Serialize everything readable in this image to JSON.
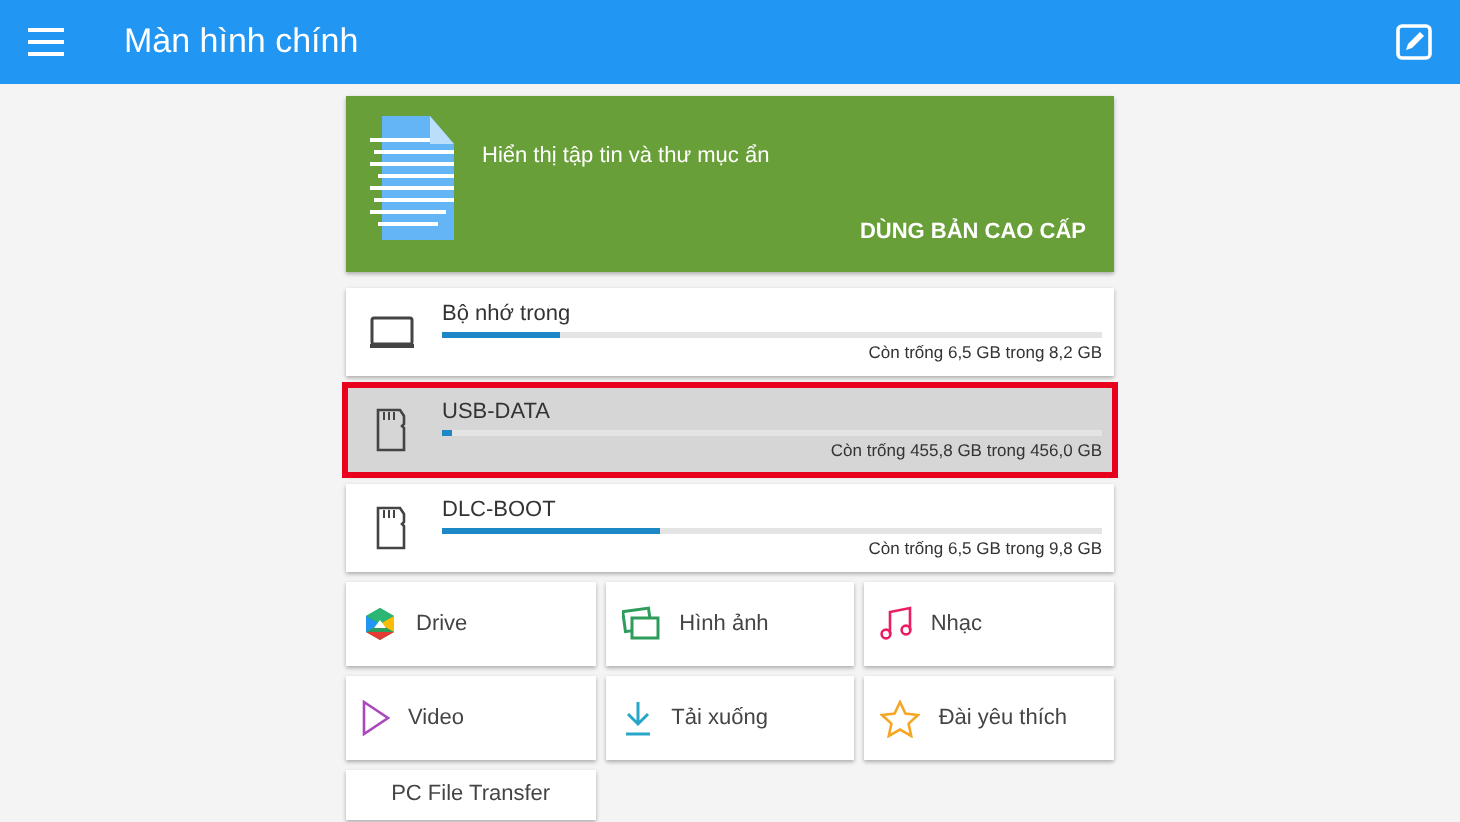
{
  "header": {
    "title": "Màn hình chính"
  },
  "banner": {
    "text": "Hiển thị tập tin và thư mục ẩn",
    "action": "DÙNG BẢN CAO CẤP"
  },
  "storage": [
    {
      "kind": "internal",
      "name": "Bộ nhớ trong",
      "level": 0.18,
      "reading": "Còn trống 6,5 GB trong 8,2 GB",
      "selected": false,
      "highlighted": false
    },
    {
      "kind": "card",
      "name": "USB-DATA",
      "level": 0.01,
      "reading": "Còn trống 455,8 GB trong 456,0 GB",
      "selected": true,
      "highlighted": true
    },
    {
      "kind": "card",
      "name": "DLC-BOOT",
      "level": 0.33,
      "reading": "Còn trống 6,5 GB trong 9,8 GB",
      "selected": false,
      "highlighted": false
    }
  ],
  "shortcuts": [
    {
      "kind": "drive",
      "label": "Drive"
    },
    {
      "kind": "images",
      "label": "Hình ảnh"
    },
    {
      "kind": "music",
      "label": "Nhạc"
    },
    {
      "kind": "video",
      "label": "Video"
    },
    {
      "kind": "download",
      "label": "Tải xuống"
    },
    {
      "kind": "star",
      "label": "Đài yêu thích"
    },
    {
      "kind": "none",
      "label": "PC File Transfer"
    }
  ]
}
